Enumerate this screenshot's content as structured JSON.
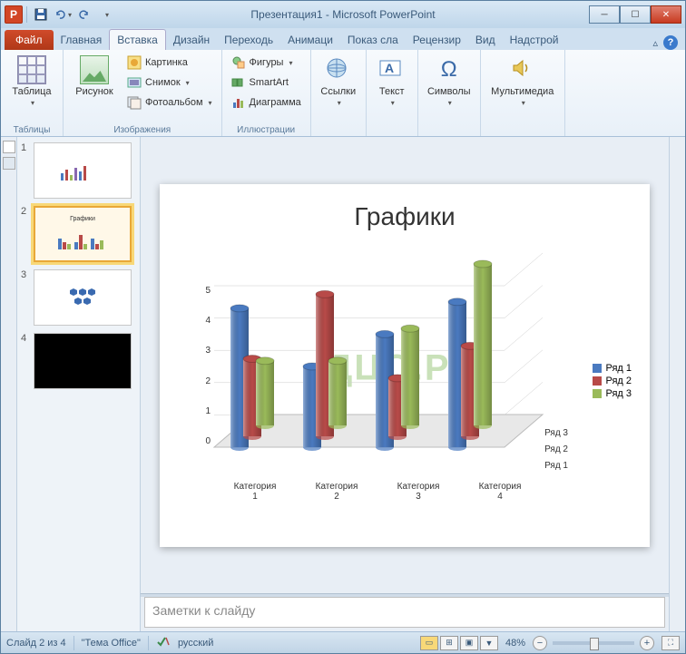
{
  "title": "Презентация1 - Microsoft PowerPoint",
  "file_tab": "Файл",
  "tabs": [
    "Главная",
    "Вставка",
    "Дизайн",
    "Переходь",
    "Анимаци",
    "Показ сла",
    "Рецензир",
    "Вид",
    "Надстрой"
  ],
  "active_tab_index": 1,
  "ribbon": {
    "tables": {
      "label": "Таблицы",
      "table": "Таблица"
    },
    "images": {
      "label": "Изображения",
      "picture": "Рисунок",
      "clipart": "Картинка",
      "screenshot": "Снимок",
      "album": "Фотоальбом"
    },
    "illustrations": {
      "label": "Иллюстрации",
      "shapes": "Фигуры",
      "smartart": "SmartArt",
      "chart": "Диаграмма"
    },
    "links": {
      "label": "",
      "links": "Ссылки"
    },
    "text": {
      "text": "Текст"
    },
    "symbols": {
      "symbols": "Символы"
    },
    "media": {
      "media": "Мультимедиа"
    }
  },
  "slides": [
    {
      "num": "1",
      "title": ""
    },
    {
      "num": "2",
      "title": "Графики"
    },
    {
      "num": "3",
      "title": ""
    },
    {
      "num": "4",
      "title": ""
    }
  ],
  "selected_slide": 1,
  "slide": {
    "title": "Графики"
  },
  "notes_placeholder": "Заметки к слайду",
  "status": {
    "slide_info": "Слайд 2 из 4",
    "theme": "\"Тема Office\"",
    "lang": "русский",
    "zoom": "48%"
  },
  "watermark": "ДЦО.РФ",
  "chart_data": {
    "type": "bar",
    "title": "",
    "categories": [
      "Категория 1",
      "Категория 2",
      "Категория 3",
      "Категория 4"
    ],
    "series": [
      {
        "name": "Ряд 1",
        "color": "#4a7ac0",
        "values": [
          4.3,
          2.5,
          3.5,
          4.5
        ]
      },
      {
        "name": "Ряд 2",
        "color": "#b84a48",
        "values": [
          2.4,
          4.4,
          1.8,
          2.8
        ]
      },
      {
        "name": "Ряд 3",
        "color": "#9aba5a",
        "values": [
          2.0,
          2.0,
          3.0,
          5.0
        ]
      }
    ],
    "depth_labels": [
      "Ряд 1",
      "Ряд 2",
      "Ряд 3"
    ],
    "ylabel": "",
    "xlabel": "",
    "ylim": [
      0,
      5
    ],
    "yticks": [
      0,
      1,
      2,
      3,
      4,
      5
    ]
  }
}
